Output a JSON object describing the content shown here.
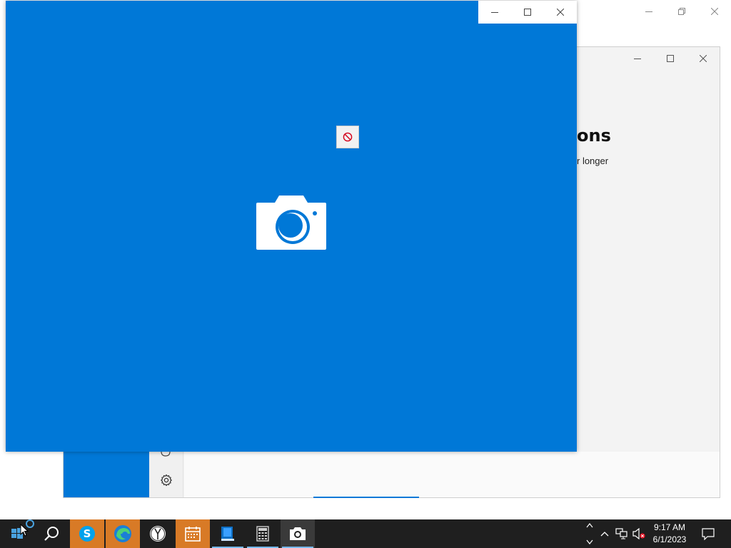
{
  "back_window": {
    "controls": [
      "minimize",
      "restore",
      "close"
    ]
  },
  "settings_window": {
    "heading_fragment": "ons",
    "subtext_fragment": "r longer",
    "icons": [
      "settings-gear-icon"
    ]
  },
  "camera_window": {
    "controls": [
      "minimize",
      "maximize",
      "close"
    ],
    "blocked_icon": "no-entry-icon",
    "center_icon": "camera-icon"
  },
  "taskbar": {
    "start": "windows-start-icon",
    "search": "search-icon",
    "apps": [
      {
        "name": "skype",
        "label": "S",
        "active": true
      },
      {
        "name": "edge",
        "active": true
      },
      {
        "name": "clock",
        "active": false
      },
      {
        "name": "calendar",
        "active": true
      },
      {
        "name": "book",
        "active": false
      },
      {
        "name": "calculator",
        "active": false
      },
      {
        "name": "camera",
        "active": false,
        "focused": true
      }
    ],
    "tray": {
      "time": "9:17 AM",
      "date": "6/1/2023"
    }
  },
  "colors": {
    "accent": "#0078d7",
    "taskbar": "#1f1f1f",
    "taskbar_active": "#d87a26"
  }
}
